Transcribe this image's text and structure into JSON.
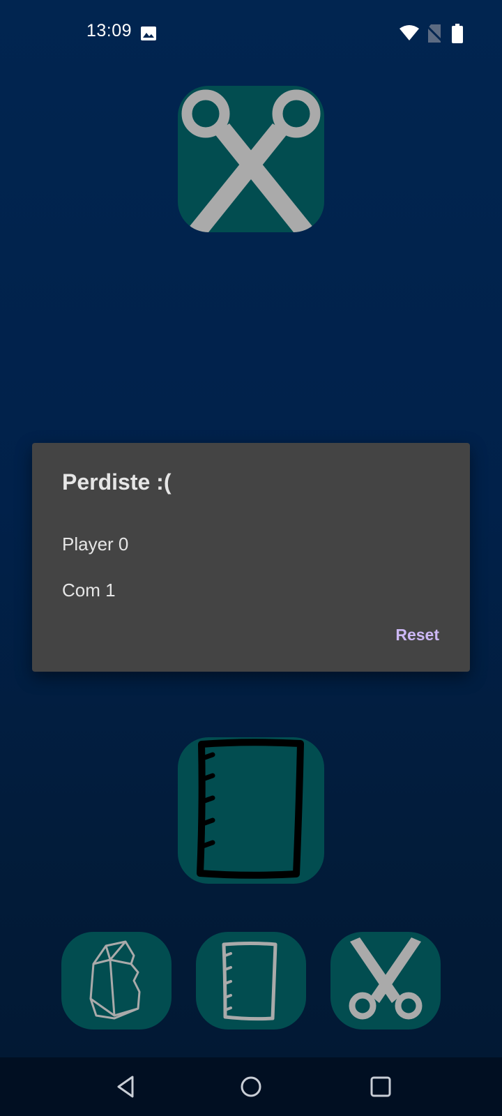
{
  "status_bar": {
    "time": "13:09",
    "icons": [
      "image-notification-icon",
      "wifi-icon",
      "no-sim-icon",
      "battery-icon"
    ]
  },
  "game": {
    "computer_choice": "scissors",
    "player_choice": "paper",
    "options": [
      {
        "name": "rock",
        "icon": "rock-icon"
      },
      {
        "name": "paper",
        "icon": "paper-icon"
      },
      {
        "name": "scissors",
        "icon": "scissors-icon"
      }
    ]
  },
  "dialog": {
    "title": "Perdiste :(",
    "player_line": "Player 0",
    "com_line": "Com 1",
    "reset_label": "Reset"
  },
  "nav": {
    "icons": [
      "back-icon",
      "home-icon",
      "recents-icon"
    ]
  },
  "colors": {
    "background": "#012550",
    "card": "#024d50",
    "dialog": "#444444",
    "accent": "#cdb8f5",
    "icon_gray": "#aaaaaa"
  }
}
